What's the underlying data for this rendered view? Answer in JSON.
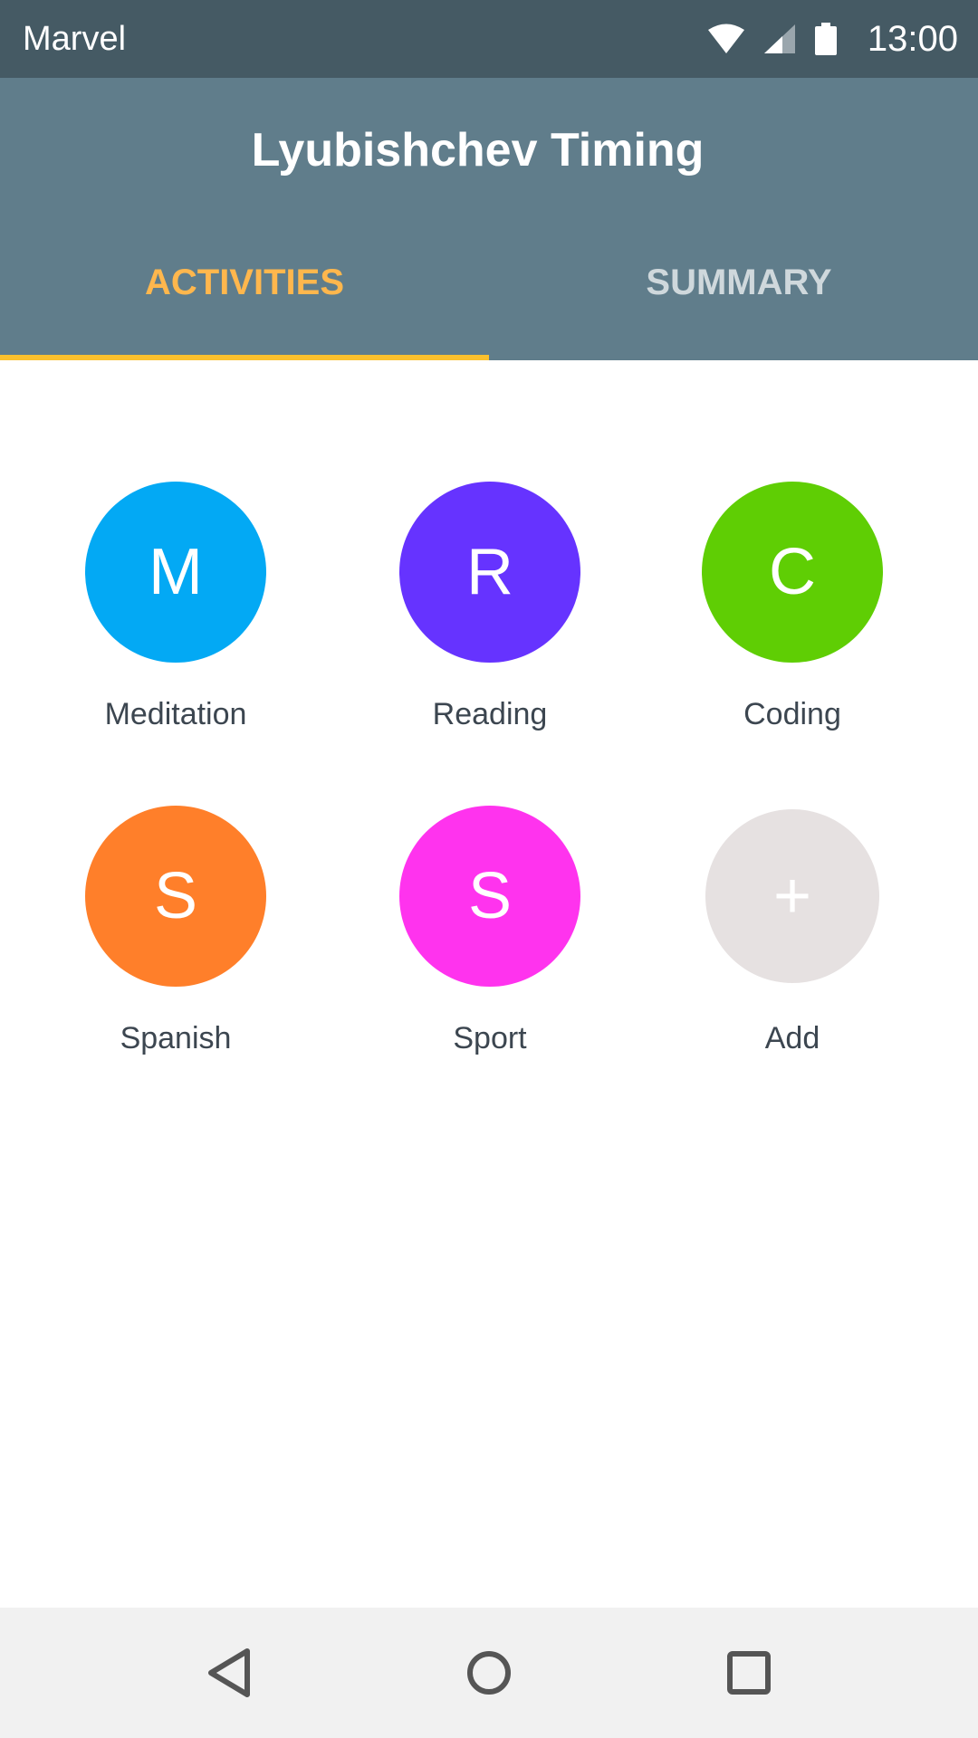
{
  "status_bar": {
    "carrier": "Marvel",
    "time": "13:00",
    "icons": [
      "wifi-icon",
      "signal-icon",
      "battery-icon"
    ]
  },
  "app_bar": {
    "title": "Lyubishchev Timing",
    "tabs": [
      {
        "label": "ACTIVITIES",
        "selected": true
      },
      {
        "label": "SUMMARY",
        "selected": false
      }
    ]
  },
  "activities": [
    {
      "initial": "M",
      "label": "Meditation",
      "color": "#03a9f4"
    },
    {
      "initial": "R",
      "label": "Reading",
      "color": "#6633ff"
    },
    {
      "initial": "C",
      "label": "Coding",
      "color": "#5fce04"
    },
    {
      "initial": "S",
      "label": "Spanish",
      "color": "#ff7f2a"
    },
    {
      "initial": "S",
      "label": "Sport",
      "color": "#ff33ee"
    }
  ],
  "add_button": {
    "symbol": "+",
    "label": "Add",
    "color": "#e6e1e1"
  },
  "nav_bar": {
    "icons": [
      "back-icon",
      "home-icon",
      "recents-icon"
    ]
  },
  "colors": {
    "status_bar": "#455a64",
    "app_bar": "#607d8b",
    "tab_selected": "#ffb74d",
    "tab_indicator": "#fbc02d"
  }
}
